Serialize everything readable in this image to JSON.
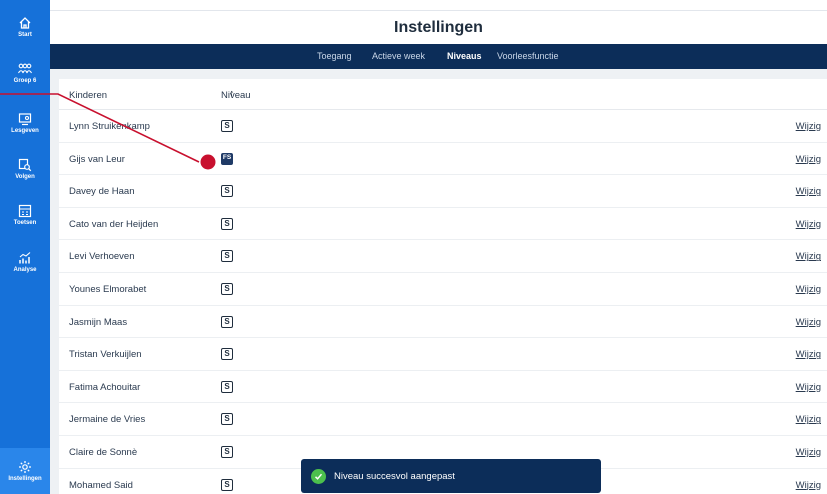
{
  "app": {
    "title": "Instellingen"
  },
  "sidebar": {
    "items": [
      {
        "label": "Start",
        "icon": "home-icon"
      },
      {
        "label": "Groep 6",
        "icon": "group-icon"
      },
      {
        "label": "Lesgeven",
        "icon": "teach-icon"
      },
      {
        "label": "Volgen",
        "icon": "track-icon"
      },
      {
        "label": "Toetsen",
        "icon": "test-icon"
      },
      {
        "label": "Analyse",
        "icon": "analysis-icon"
      }
    ],
    "settings": {
      "label": "Instellingen",
      "icon": "gear-icon"
    }
  },
  "tabs": [
    {
      "label": "Toegang",
      "active": false
    },
    {
      "label": "Actieve week",
      "active": false
    },
    {
      "label": "Niveaus",
      "active": true
    },
    {
      "label": "Voorleesfunctie",
      "active": false
    }
  ],
  "table": {
    "col_children": "Kinderen",
    "col_level": "Niveau",
    "sort_icon": "arrow-up-icon",
    "edit_label": "Wijzig",
    "rows": [
      {
        "name": "Lynn Struikenkamp",
        "level": "S"
      },
      {
        "name": "Gijs van Leur",
        "level": "FS"
      },
      {
        "name": "Davey de Haan",
        "level": "S"
      },
      {
        "name": "Cato van der Heijden",
        "level": "S"
      },
      {
        "name": "Levi Verhoeven",
        "level": "S"
      },
      {
        "name": "Younes Elmorabet",
        "level": "S"
      },
      {
        "name": "Jasmijn Maas",
        "level": "S"
      },
      {
        "name": "Tristan Verkuijlen",
        "level": "S"
      },
      {
        "name": "Fatima Achouitar",
        "level": "S"
      },
      {
        "name": "Jermaine de Vries",
        "level": "S"
      },
      {
        "name": "Claire de Sonnè",
        "level": "S"
      },
      {
        "name": "Mohamed Said",
        "level": "S"
      }
    ]
  },
  "toast": {
    "message": "Niveau succesvol aangepast",
    "icon": "check-icon"
  },
  "colors": {
    "sidebar": "#1671d9",
    "tabbar": "#0c2d59",
    "annotation": "#c8102e",
    "success": "#4cc04d"
  }
}
